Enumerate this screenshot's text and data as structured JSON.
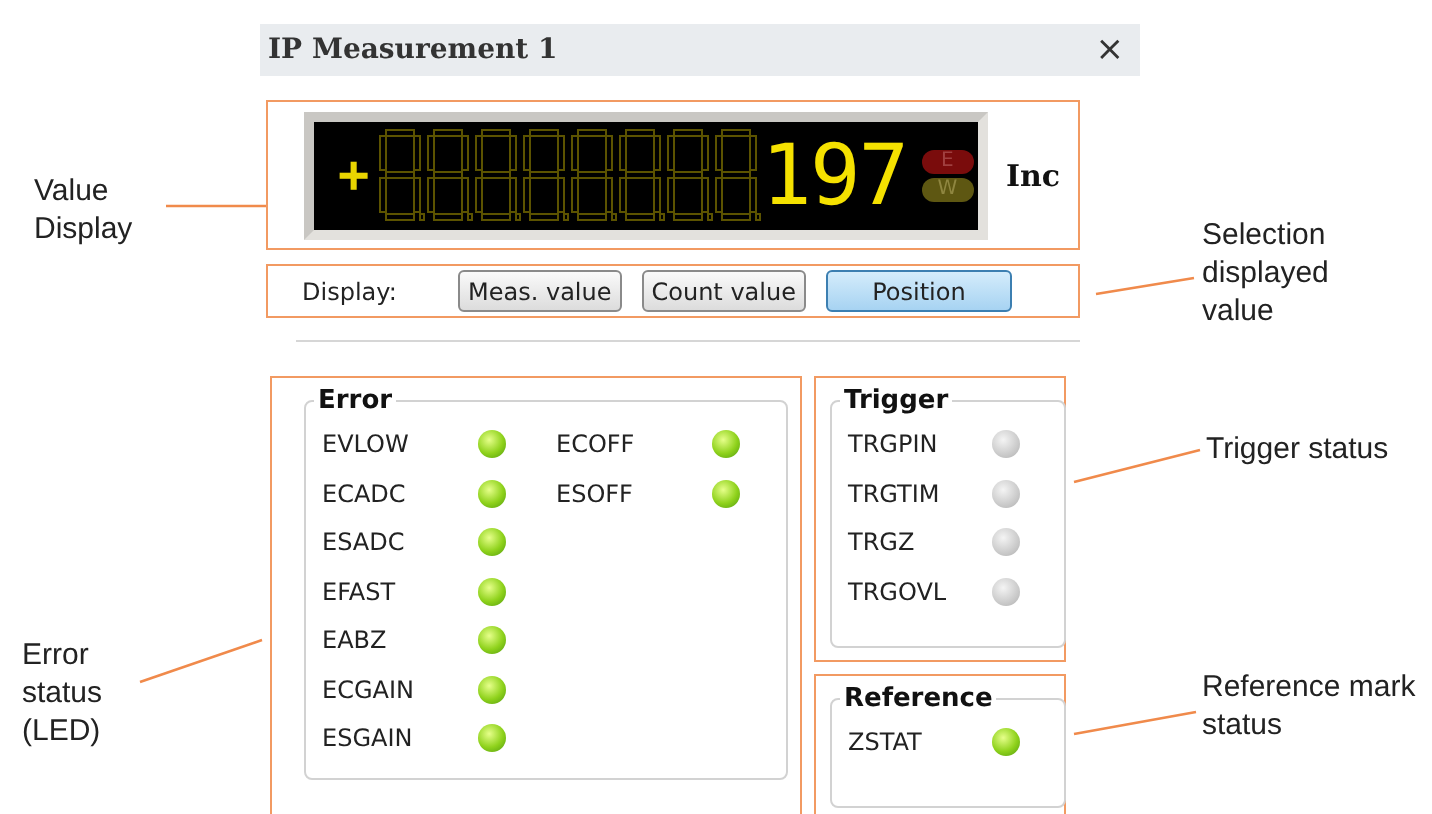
{
  "window": {
    "title": "IP Measurement 1",
    "close": "×"
  },
  "value_display": {
    "sign": "+",
    "value": "197",
    "unit": "Inc",
    "indicators": [
      {
        "label": "E",
        "color": "#7a0c0c"
      },
      {
        "label": "W",
        "color": "#5e5712"
      }
    ]
  },
  "display_selector": {
    "label": "Display:",
    "buttons": [
      {
        "label": "Meas. value",
        "selected": false
      },
      {
        "label": "Count value",
        "selected": false
      },
      {
        "label": "Position",
        "selected": true
      }
    ]
  },
  "groups": [
    {
      "title": "Error",
      "kind": "error",
      "leds": [
        {
          "label": "EVLOW",
          "on": true
        },
        {
          "label": "ECADC",
          "on": true
        },
        {
          "label": "ESADC",
          "on": true
        },
        {
          "label": "EFAST",
          "on": true
        },
        {
          "label": "EABZ",
          "on": true
        },
        {
          "label": "ECGAIN",
          "on": true
        },
        {
          "label": "ESGAIN",
          "on": true
        },
        {
          "label": "ECOFF",
          "on": true
        },
        {
          "label": "ESOFF",
          "on": true
        }
      ]
    },
    {
      "title": "Trigger",
      "kind": "trigger",
      "leds": [
        {
          "label": "TRGPIN",
          "on": false
        },
        {
          "label": "TRGTIM",
          "on": false
        },
        {
          "label": "TRGZ",
          "on": false
        },
        {
          "label": "TRGOVL",
          "on": false
        }
      ]
    },
    {
      "title": "Reference",
      "kind": "reference",
      "leds": [
        {
          "label": "ZSTAT",
          "on": true
        }
      ]
    }
  ],
  "annotations": [
    {
      "text": "Value Display"
    },
    {
      "text": "Selection displayed value"
    },
    {
      "text": "Trigger status"
    },
    {
      "text": "Error status (LED)"
    },
    {
      "text": "Reference mark status"
    }
  ]
}
